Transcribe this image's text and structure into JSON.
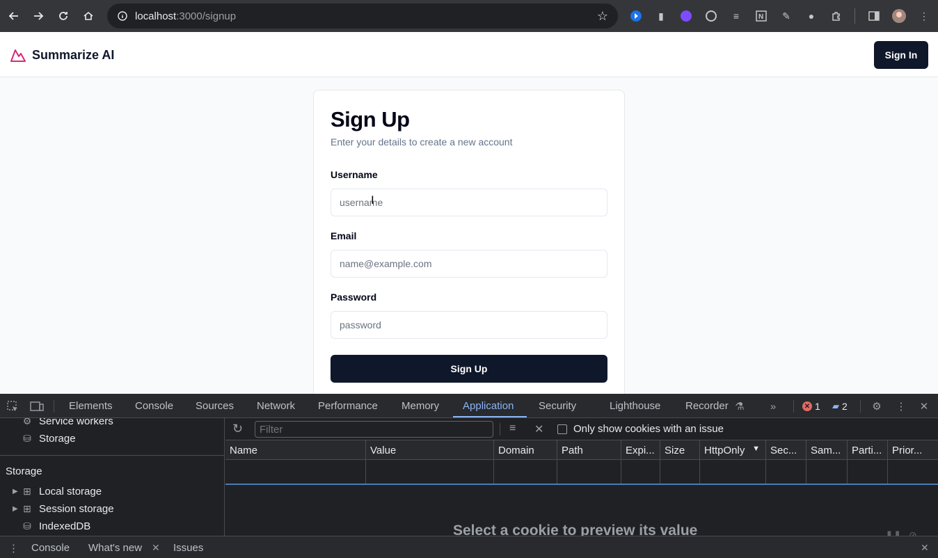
{
  "browser": {
    "url_host": "localhost",
    "url_path": ":3000/signup",
    "icons": [
      "back-icon",
      "forward-icon",
      "reload-icon",
      "home-icon",
      "info-icon",
      "star-icon",
      "extension-icon",
      "sidebar-icon",
      "profile-avatar",
      "menu-icon"
    ]
  },
  "header": {
    "brand": "Summarize AI",
    "signin_label": "Sign In",
    "logo_color": "#db2777"
  },
  "form": {
    "title": "Sign Up",
    "subtitle": "Enter your details to create a new account",
    "username_label": "Username",
    "username_placeholder": "username",
    "email_label": "Email",
    "email_placeholder": "name@example.com",
    "password_label": "Password",
    "password_placeholder": "password",
    "submit_label": "Sign Up"
  },
  "devtools": {
    "tabs": [
      "Elements",
      "Console",
      "Sources",
      "Network",
      "Performance",
      "Memory",
      "Application",
      "Security",
      "Lighthouse",
      "Recorder"
    ],
    "active_tab": "Application",
    "error_count": "1",
    "message_count": "2",
    "sidebar": {
      "service_workers": "Service workers",
      "storage_item": "Storage",
      "storage_heading": "Storage",
      "local_storage": "Local storage",
      "session_storage": "Session storage",
      "indexeddb": "IndexedDB"
    },
    "cookies": {
      "filter_placeholder": "Filter",
      "only_issue_label": "Only show cookies with an issue",
      "columns": [
        "Name",
        "Value",
        "Domain",
        "Path",
        "Expi...",
        "Size",
        "HttpOnly",
        "Sec...",
        "Sam...",
        "Parti...",
        "Prior..."
      ],
      "preview_text": "Select a cookie to preview its value"
    },
    "drawer": {
      "console": "Console",
      "whats_new": "What's new",
      "issues": "Issues"
    },
    "accent_color": "#8ab4f8"
  }
}
